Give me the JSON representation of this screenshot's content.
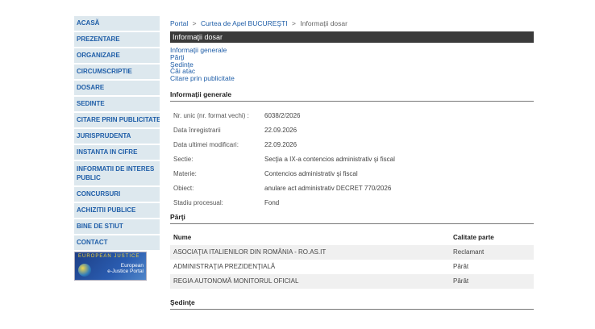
{
  "sidebar": {
    "items": [
      {
        "label": "ACASĂ"
      },
      {
        "label": "PREZENTARE"
      },
      {
        "label": "ORGANIZARE"
      },
      {
        "label": "CIRCUMSCRIPTIE"
      },
      {
        "label": "DOSARE"
      },
      {
        "label": "SEDINTE"
      },
      {
        "label": "CITARE PRIN PUBLICITATE"
      },
      {
        "label": "JURISPRUDENTA"
      },
      {
        "label": "INSTANTA IN CIFRE"
      },
      {
        "label": "INFORMATII DE INTERES PUBLIC"
      },
      {
        "label": "CONCURSURI"
      },
      {
        "label": "ACHIZITII PUBLICE"
      },
      {
        "label": "BINE DE STIUT"
      },
      {
        "label": "CONTACT"
      }
    ],
    "ejustice": {
      "line1": "European",
      "line2": "e-Justice Portal",
      "top": "EUROPEAN JUSTICE"
    }
  },
  "breadcrumb": {
    "portal": "Portal",
    "sep": ">",
    "court": "Curtea de Apel BUCUREŞTI",
    "current": "Informaţii dosar"
  },
  "page_title": "Informaţii dosar",
  "quick_links": [
    "Informaţii generale",
    "Părţi",
    "Şedinţe",
    "Căi atac",
    "Citare prin publicitate"
  ],
  "general": {
    "heading": "Informaţii generale",
    "rows": [
      {
        "label": "Nr. unic (nr. format vechi) :",
        "value": "6038/2/2026"
      },
      {
        "label": "Data înregistrarii",
        "value": "22.09.2026"
      },
      {
        "label": "Data ultimei modificari:",
        "value": "22.09.2026"
      },
      {
        "label": "Sectie:",
        "value": "Secţia a IX-a contencios administrativ şi fiscal"
      },
      {
        "label": "Materie:",
        "value": "Contencios administrativ şi fiscal"
      },
      {
        "label": "Obiect:",
        "value": "anulare act administrativ DECRET 770/2026"
      },
      {
        "label": "Stadiu procesual:",
        "value": "Fond"
      }
    ]
  },
  "parties": {
    "heading": "Părţi",
    "col_name": "Nume",
    "col_role": "Calitate parte",
    "rows": [
      {
        "name": "ASOCIAŢIA ITALIENILOR DIN ROMÂNIA - RO.AS.IT",
        "role": "Reclamant"
      },
      {
        "name": "ADMINISTRAŢIA PREZIDENŢIALĂ",
        "role": "Pârât"
      },
      {
        "name": "REGIA AUTONOMĂ MONITORUL OFICIAL",
        "role": "Pârât"
      }
    ]
  },
  "sessions": {
    "heading": "Şedinţe"
  }
}
